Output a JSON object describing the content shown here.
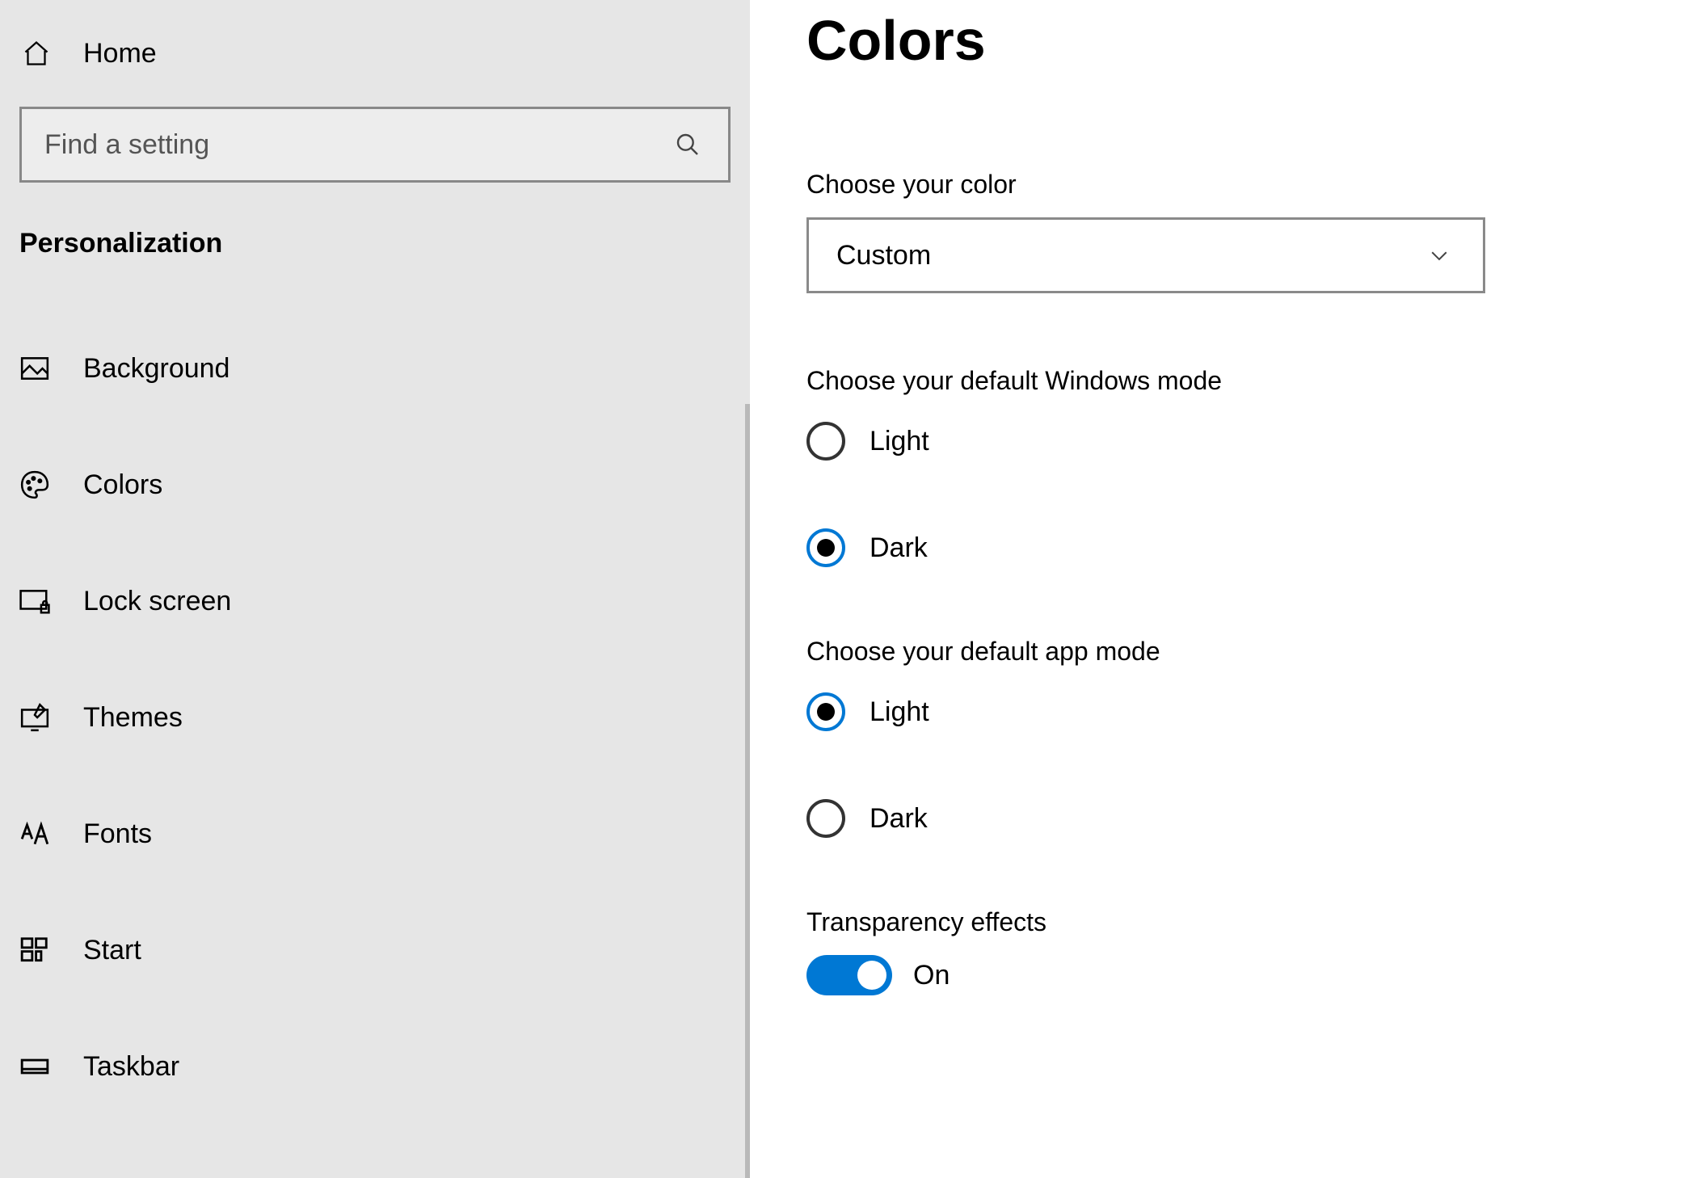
{
  "sidebar": {
    "home_label": "Home",
    "search_placeholder": "Find a setting",
    "section": "Personalization",
    "items": [
      {
        "label": "Background"
      },
      {
        "label": "Colors"
      },
      {
        "label": "Lock screen"
      },
      {
        "label": "Themes"
      },
      {
        "label": "Fonts"
      },
      {
        "label": "Start"
      },
      {
        "label": "Taskbar"
      }
    ]
  },
  "main": {
    "title": "Colors",
    "choose_color_label": "Choose your color",
    "choose_color_value": "Custom",
    "windows_mode_label": "Choose your default Windows mode",
    "windows_mode_options": [
      "Light",
      "Dark"
    ],
    "windows_mode_selected": "Dark",
    "app_mode_label": "Choose your default app mode",
    "app_mode_options": [
      "Light",
      "Dark"
    ],
    "app_mode_selected": "Light",
    "transparency_label": "Transparency effects",
    "transparency_state": "On"
  }
}
